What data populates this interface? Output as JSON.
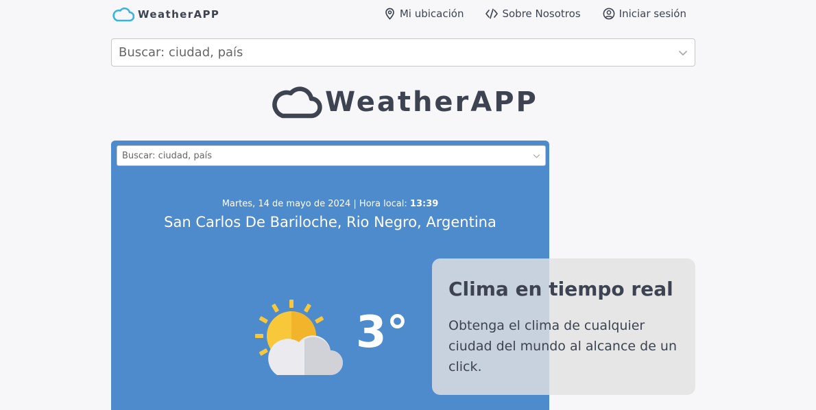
{
  "nav": {
    "brand": "WeatherAPP",
    "links": [
      {
        "label": "Mi ubicación",
        "icon": "location-pin-icon"
      },
      {
        "label": "Sobre Nosotros",
        "icon": "code-icon"
      },
      {
        "label": "Iniciar sesión",
        "icon": "user-circle-icon"
      }
    ]
  },
  "search": {
    "placeholder": "Buscar: ciudad, país"
  },
  "hero": {
    "title": "WeatherAPP"
  },
  "weather": {
    "search_placeholder": "Buscar: ciudad, país",
    "date": "Martes, 14 de mayo de 2024 | Hora local:",
    "time": "13:39",
    "location": "San Carlos De Bariloche, Rio Negro, Argentina",
    "temperature": "3°",
    "condition_icon": "partly-cloudy-icon"
  },
  "info": {
    "title": "Clima en tiempo real",
    "text": "Obtenga el clima de cualquier ciudad del mundo al alcance de un click."
  },
  "colors": {
    "card_blue": "#4e8bcc",
    "text_dark": "#3d4350",
    "brand_cloud": "#35b3e6",
    "sun": "#f9c83a"
  }
}
